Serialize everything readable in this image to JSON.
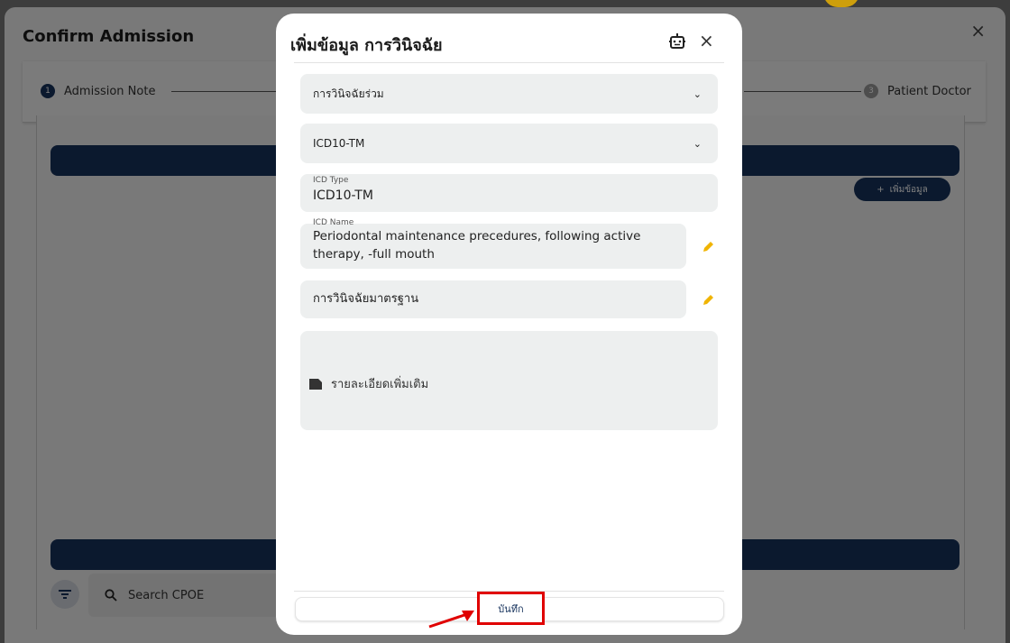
{
  "background": {
    "title": "Confirm Admission",
    "close_glyph": "×",
    "steps": [
      {
        "number": "1",
        "label": "Admission Note",
        "state": "active"
      },
      {
        "number": "3",
        "label": "Patient Doctor",
        "state": "inactive"
      }
    ],
    "add_button_label": "เพิ่มข้อมูล",
    "search_placeholder": "Search CPOE"
  },
  "modal": {
    "title": "เพิ่มข้อมูล การวินิจฉัย",
    "close_glyph": "×",
    "diagnosis_type_select": {
      "value": "การวินิจฉัยร่วม"
    },
    "code_system_select": {
      "value": "ICD10-TM"
    },
    "icd_type": {
      "label": "ICD Type",
      "value": "ICD10-TM"
    },
    "icd_name": {
      "label": "ICD Name",
      "value": "Periodontal maintenance precedures, following active therapy, -full mouth"
    },
    "standard_diagnosis": {
      "placeholder": "การวินิจฉัยมาตรฐาน"
    },
    "details": {
      "placeholder": "รายละเอียดเพิ่มเติม"
    },
    "save_label": "บันทึก"
  },
  "colors": {
    "primary": "#16325c",
    "accent_edit": "#f0b400",
    "highlight": "#e00000"
  },
  "icons": [
    "robot-icon",
    "close-icon",
    "chevron-down-icon",
    "edit-pencil-icon",
    "note-icon",
    "filter-icon",
    "search-icon",
    "plus-icon"
  ]
}
